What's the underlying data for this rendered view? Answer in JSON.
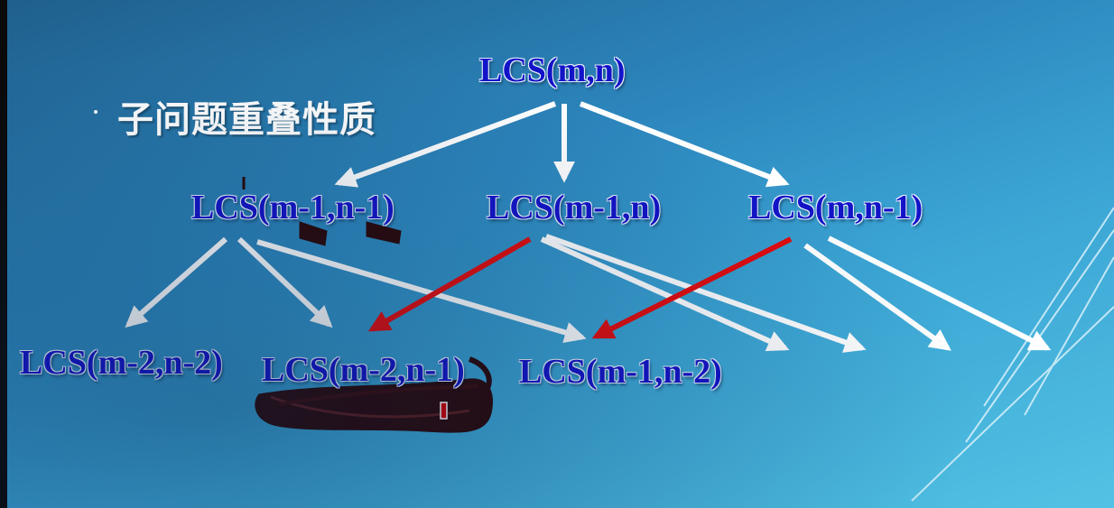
{
  "slide": {
    "title": "子问题重叠性质"
  },
  "nodes": {
    "root": "LCS(m,n)",
    "a": "LCS(m-1,n-1)",
    "b": "LCS(m-1,n)",
    "c": "LCS(m,n-1)",
    "d": "LCS(m-2,n-2)",
    "e": "LCS(m-2,n-1)",
    "f": "LCS(m-1,n-2)"
  },
  "colors": {
    "arrow": "#ffffff",
    "highlight_arrow": "#e30b0b",
    "node_text": "#1313c8",
    "ink": "#2a0707"
  }
}
